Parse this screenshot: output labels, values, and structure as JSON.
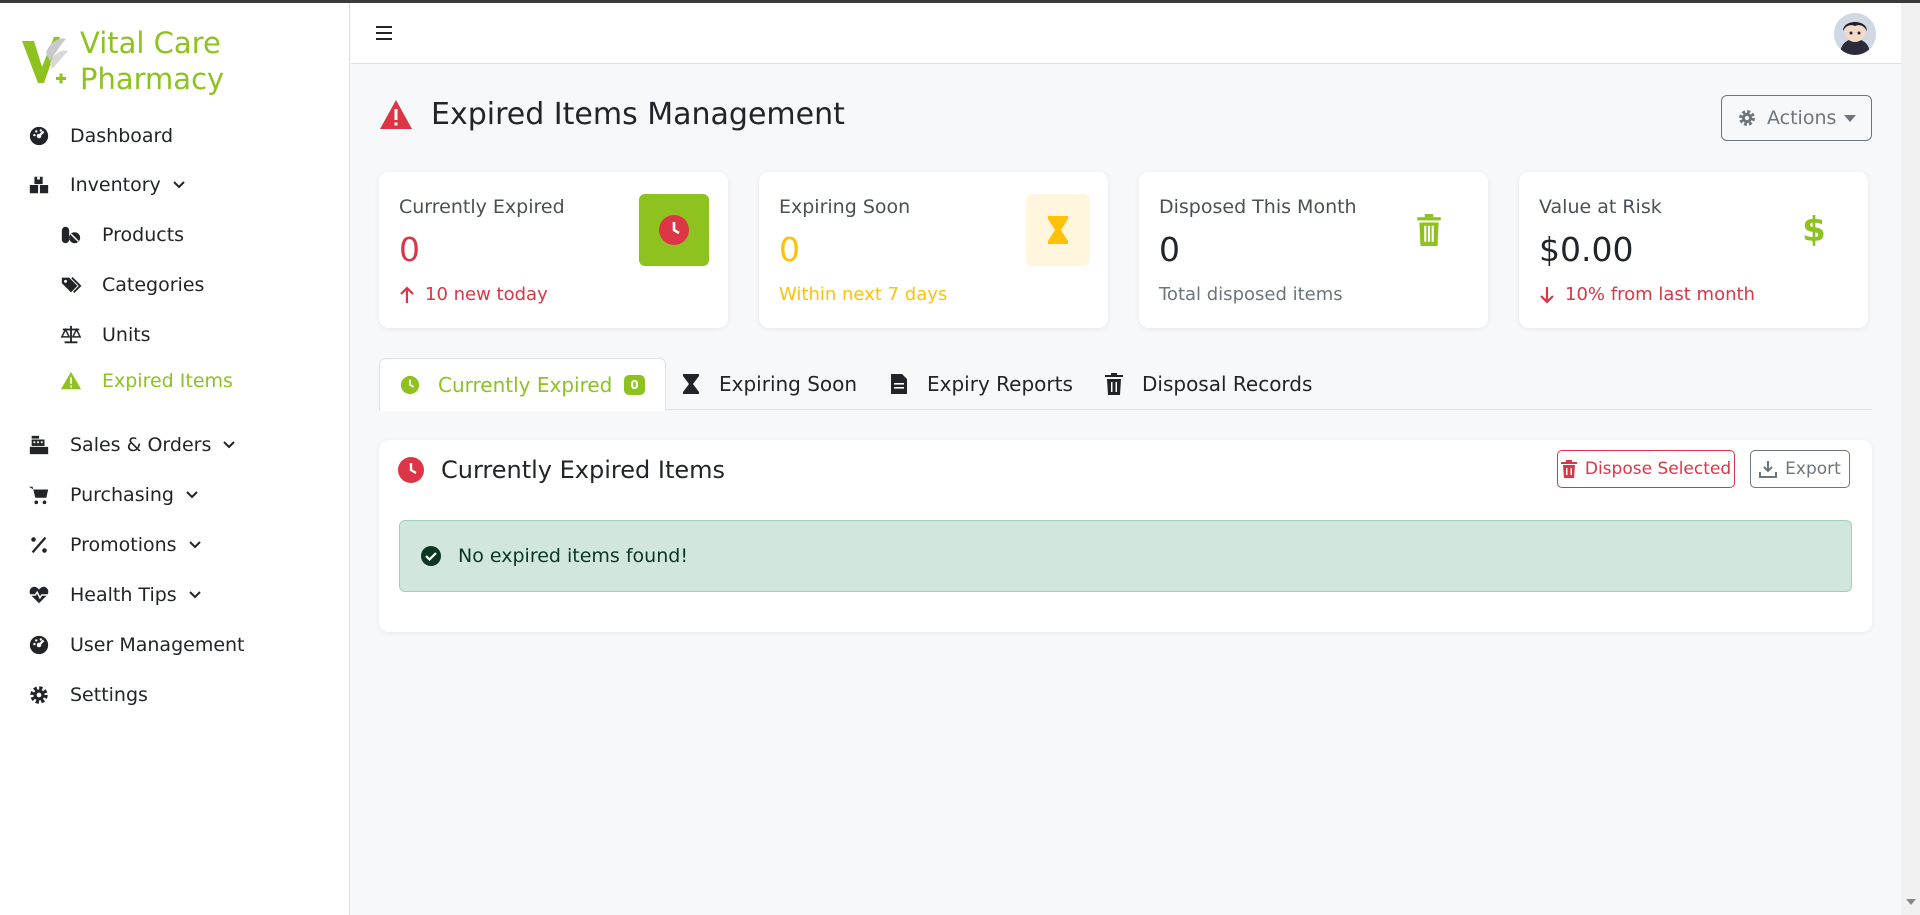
{
  "brand": {
    "name_line1": "Vital Care",
    "name_line2": "Pharmacy",
    "accent_color": "#8dc21f"
  },
  "sidebar": {
    "items": [
      {
        "label": "Dashboard",
        "icon": "gauge-icon"
      },
      {
        "label": "Inventory",
        "icon": "boxes-icon",
        "expandable": true
      },
      {
        "label": "Products",
        "icon": "pills-icon",
        "sub": true
      },
      {
        "label": "Categories",
        "icon": "tags-icon",
        "sub": true
      },
      {
        "label": "Units",
        "icon": "scale-icon",
        "sub": true
      },
      {
        "label": "Expired Items",
        "icon": "warning-icon",
        "sub": true,
        "active": true
      },
      {
        "label": "Sales & Orders",
        "icon": "cash-register-icon",
        "expandable": true
      },
      {
        "label": "Purchasing",
        "icon": "cart-icon",
        "expandable": true
      },
      {
        "label": "Promotions",
        "icon": "percent-icon",
        "expandable": true
      },
      {
        "label": "Health Tips",
        "icon": "heart-pulse-icon",
        "expandable": true
      },
      {
        "label": "User Management",
        "icon": "gauge-icon"
      },
      {
        "label": "Settings",
        "icon": "gear-icon"
      }
    ]
  },
  "header": {
    "page_title": "Expired Items Management",
    "actions_label": "Actions"
  },
  "stats": [
    {
      "label": "Currently Expired",
      "value": "0",
      "sub": "10 new today",
      "icon": "clock-icon"
    },
    {
      "label": "Expiring Soon",
      "value": "0",
      "sub": "Within next 7 days",
      "icon": "hourglass-icon"
    },
    {
      "label": "Disposed This Month",
      "value": "0",
      "sub": "Total disposed items",
      "icon": "trash-icon"
    },
    {
      "label": "Value at Risk",
      "value": "$0.00",
      "sub": "10% from last month",
      "icon": "dollar-icon"
    }
  ],
  "tabs": [
    {
      "label": "Currently Expired",
      "count": "0",
      "active": true
    },
    {
      "label": "Expiring Soon"
    },
    {
      "label": "Expiry Reports"
    },
    {
      "label": "Disposal Records"
    }
  ],
  "panel": {
    "title": "Currently Expired Items",
    "dispose_label": "Dispose Selected",
    "export_label": "Export",
    "empty_message": "No expired items found!"
  },
  "colors": {
    "danger": "#dc3545",
    "warning": "#ffc107",
    "success_bg": "#d1e7dd"
  }
}
